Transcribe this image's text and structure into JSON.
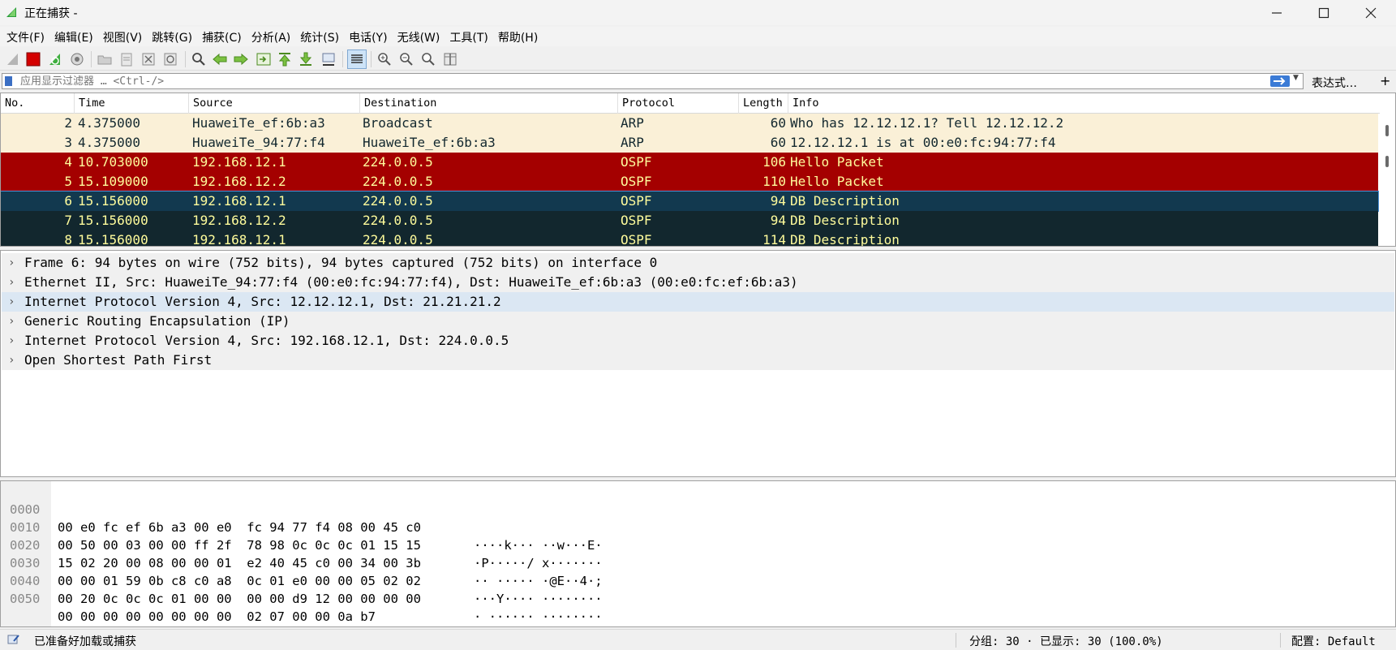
{
  "window": {
    "title": "正在捕获 -",
    "min_glyph": "—",
    "max_glyph": "☐",
    "close_glyph": "✕"
  },
  "menu": [
    "文件(F)",
    "编辑(E)",
    "视图(V)",
    "跳转(G)",
    "捕获(C)",
    "分析(A)",
    "统计(S)",
    "电话(Y)",
    "无线(W)",
    "工具(T)",
    "帮助(H)"
  ],
  "toolbar": {
    "icons": [
      "shark-fin-start-icon",
      "stop-capture-icon",
      "restart-capture-icon",
      "capture-options-icon",
      "open-file-icon",
      "save-file-icon",
      "close-file-icon",
      "reload-file-icon",
      "find-packet-icon",
      "go-back-icon",
      "go-forward-icon",
      "go-to-packet-icon",
      "first-packet-icon",
      "last-packet-icon",
      "autoscroll-icon",
      "colorize-icon",
      "zoom-in-icon",
      "zoom-out-icon",
      "normal-size-icon",
      "resize-columns-icon"
    ]
  },
  "filter": {
    "placeholder": "应用显示过滤器 … <Ctrl-/>",
    "expression_label": "表达式…",
    "plus": "+",
    "dropdown": "▼"
  },
  "packet_list": {
    "columns": [
      "No.",
      "Time",
      "Source",
      "Destination",
      "Protocol",
      "Length",
      "Info"
    ],
    "rows": [
      {
        "no": "2",
        "time": "4.375000",
        "source": "HuaweiTe_ef:6b:a3",
        "destination": "Broadcast",
        "protocol": "ARP",
        "length": "60",
        "info": "Who has 12.12.12.1? Tell 12.12.12.2",
        "bg": "#faf0d7",
        "fg": "#12272e"
      },
      {
        "no": "3",
        "time": "4.375000",
        "source": "HuaweiTe_94:77:f4",
        "destination": "HuaweiTe_ef:6b:a3",
        "protocol": "ARP",
        "length": "60",
        "info": "12.12.12.1 is at 00:e0:fc:94:77:f4",
        "bg": "#faf0d7",
        "fg": "#12272e"
      },
      {
        "no": "4",
        "time": "10.703000",
        "source": "192.168.12.1",
        "destination": "224.0.0.5",
        "protocol": "OSPF",
        "length": "106",
        "info": "Hello Packet",
        "bg": "#a40000",
        "fg": "#fffc9c"
      },
      {
        "no": "5",
        "time": "15.109000",
        "source": "192.168.12.2",
        "destination": "224.0.0.5",
        "protocol": "OSPF",
        "length": "110",
        "info": "Hello Packet",
        "bg": "#a40000",
        "fg": "#fffc9c"
      },
      {
        "no": "6",
        "time": "15.156000",
        "source": "192.168.12.1",
        "destination": "224.0.0.5",
        "protocol": "OSPF",
        "length": "94",
        "info": "DB Description",
        "bg": "#12394f",
        "fg": "#fffc9c",
        "selected": true
      },
      {
        "no": "7",
        "time": "15.156000",
        "source": "192.168.12.2",
        "destination": "224.0.0.5",
        "protocol": "OSPF",
        "length": "94",
        "info": "DB Description",
        "bg": "#12272e",
        "fg": "#fffc9c"
      },
      {
        "no": "8",
        "time": "15.156000",
        "source": "192.168.12.1",
        "destination": "224.0.0.5",
        "protocol": "OSPF",
        "length": "114",
        "info": "DB Description",
        "bg": "#12272e",
        "fg": "#fffc9c"
      }
    ]
  },
  "details": {
    "rows": [
      {
        "text": "Frame 6: 94 bytes on wire (752 bits), 94 bytes captured (752 bits) on interface 0"
      },
      {
        "text": "Ethernet II, Src: HuaweiTe_94:77:f4 (00:e0:fc:94:77:f4), Dst: HuaweiTe_ef:6b:a3 (00:e0:fc:ef:6b:a3)"
      },
      {
        "text": "Internet Protocol Version 4, Src: 12.12.12.1, Dst: 21.21.21.2",
        "highlighted": true
      },
      {
        "text": "Generic Routing Encapsulation (IP)"
      },
      {
        "text": "Internet Protocol Version 4, Src: 192.168.12.1, Dst: 224.0.0.5"
      },
      {
        "text": "Open Shortest Path First"
      }
    ],
    "arrow": "›"
  },
  "bytes": {
    "rows": [
      {
        "offset": "0000",
        "hex": "00 e0 fc ef 6b a3 00 e0  fc 94 77 f4 08 00 45 c0",
        "ascii": "····k··· ··w···E·"
      },
      {
        "offset": "0010",
        "hex": "00 50 00 03 00 00 ff 2f  78 98 0c 0c 0c 01 15 15",
        "ascii": "·P·····/ x·······"
      },
      {
        "offset": "0020",
        "hex": "15 02 20 00 08 00 00 01  e2 40 45 c0 00 34 00 3b",
        "ascii": "·· ····· ·@E··4·;"
      },
      {
        "offset": "0030",
        "hex": "00 00 01 59 0b c8 c0 a8  0c 01 e0 00 00 05 02 02",
        "ascii": "···Y···· ········"
      },
      {
        "offset": "0040",
        "hex": "00 20 0c 0c 0c 01 00 00  00 00 d9 12 00 00 00 00",
        "ascii": "· ······ ········"
      },
      {
        "offset": "0050",
        "hex": "00 00 00 00 00 00 00 00  02 07 00 00 0a b7",
        "ascii": "········ ······"
      }
    ]
  },
  "status": {
    "ready": "已准备好加载或捕获",
    "packets": "分组: 30 · 已显示: 30 (100.0%)",
    "profile": "配置: Default"
  }
}
